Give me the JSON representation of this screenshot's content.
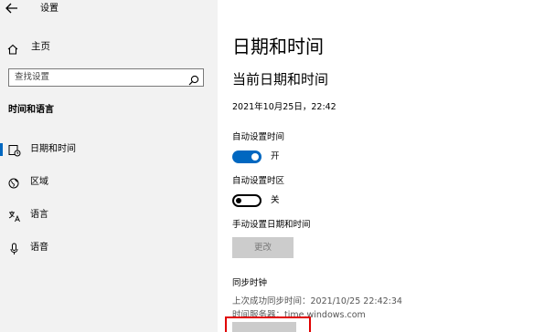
{
  "window": {
    "title": "设置"
  },
  "sidebar": {
    "home_label": "主页",
    "search_placeholder": "查找设置",
    "section_title": "时间和语言",
    "items": [
      {
        "label": "日期和时间",
        "icon": "calendar-clock-icon",
        "selected": true
      },
      {
        "label": "区域",
        "icon": "globe-icon",
        "selected": false
      },
      {
        "label": "语言",
        "icon": "language-icon",
        "selected": false
      },
      {
        "label": "语音",
        "icon": "microphone-icon",
        "selected": false
      }
    ]
  },
  "main": {
    "page_title": "日期和时间",
    "subtitle": "当前日期和时间",
    "current_datetime": "2021年10月25日，22:42",
    "auto_time": {
      "label": "自动设置时间",
      "state_text": "开",
      "on": true
    },
    "auto_timezone": {
      "label": "自动设置时区",
      "state_text": "关",
      "on": false
    },
    "manual": {
      "label": "手动设置日期和时间",
      "button": "更改"
    },
    "sync": {
      "title": "同步时钟",
      "last_sync": "上次成功同步时间：2021/10/25 22:42:34",
      "server": "时间服务器：time.windows.com"
    }
  },
  "colors": {
    "accent": "#0067c0",
    "sidebar_bg": "#f2f2f2",
    "highlight": "#e00000"
  }
}
